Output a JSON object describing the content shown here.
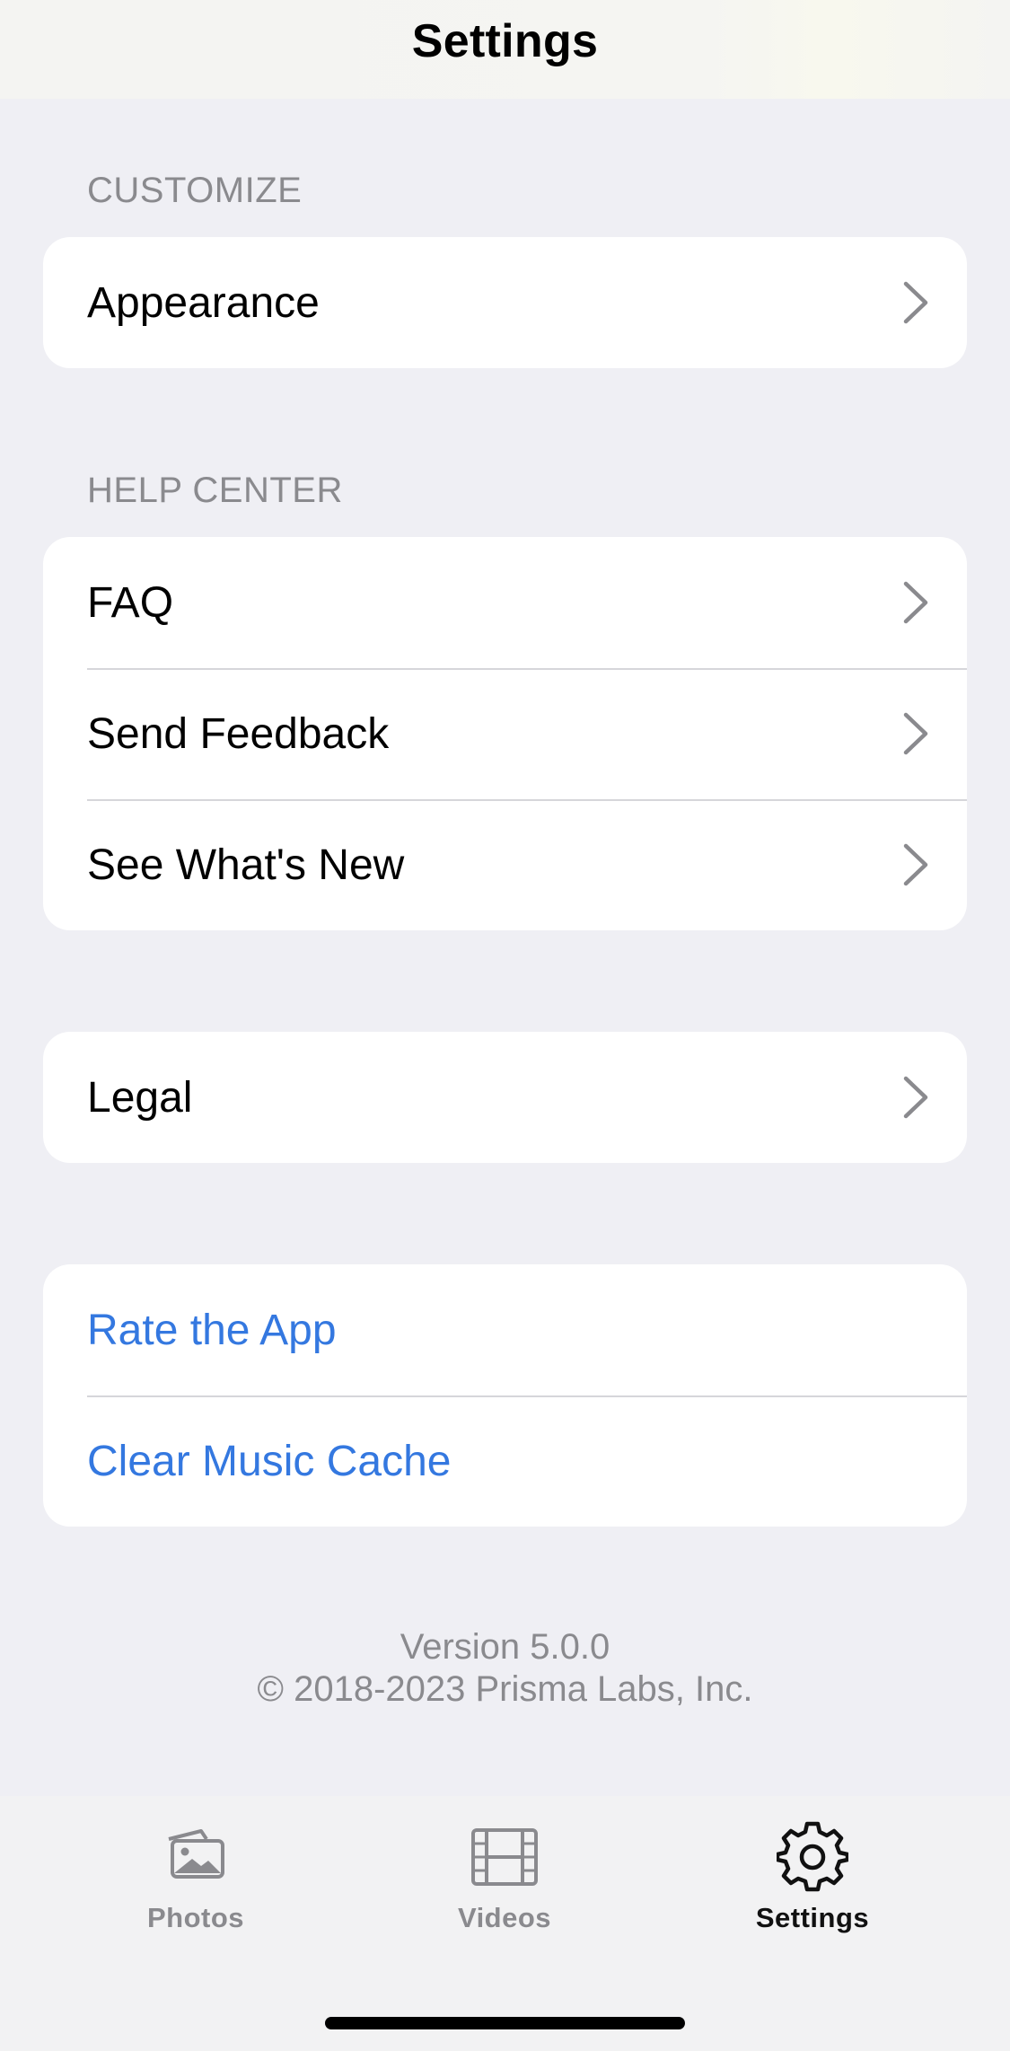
{
  "navbar": {
    "title": "Settings"
  },
  "sections": {
    "customize_header": "CUSTOMIZE",
    "help_header": "HELP CENTER"
  },
  "rows": {
    "appearance": "Appearance",
    "faq": "FAQ",
    "send_feedback": "Send Feedback",
    "whats_new": "See What's New",
    "legal": "Legal",
    "rate_app": "Rate the App",
    "clear_cache": "Clear Music Cache"
  },
  "footer": {
    "version": "Version 5.0.0",
    "copyright": "© 2018-2023 Prisma Labs, Inc."
  },
  "tabbar": {
    "photos": "Photos",
    "videos": "Videos",
    "settings": "Settings",
    "active": "settings"
  },
  "colors": {
    "background": "#efeff4",
    "link": "#3478e0",
    "secondary_text": "#8a8a8e",
    "chevron": "#8a8a8e"
  },
  "icons": {
    "row_disclosure": "chevron-right-icon",
    "photos_tab": "photos-icon",
    "videos_tab": "film-icon",
    "settings_tab": "gear-icon"
  }
}
